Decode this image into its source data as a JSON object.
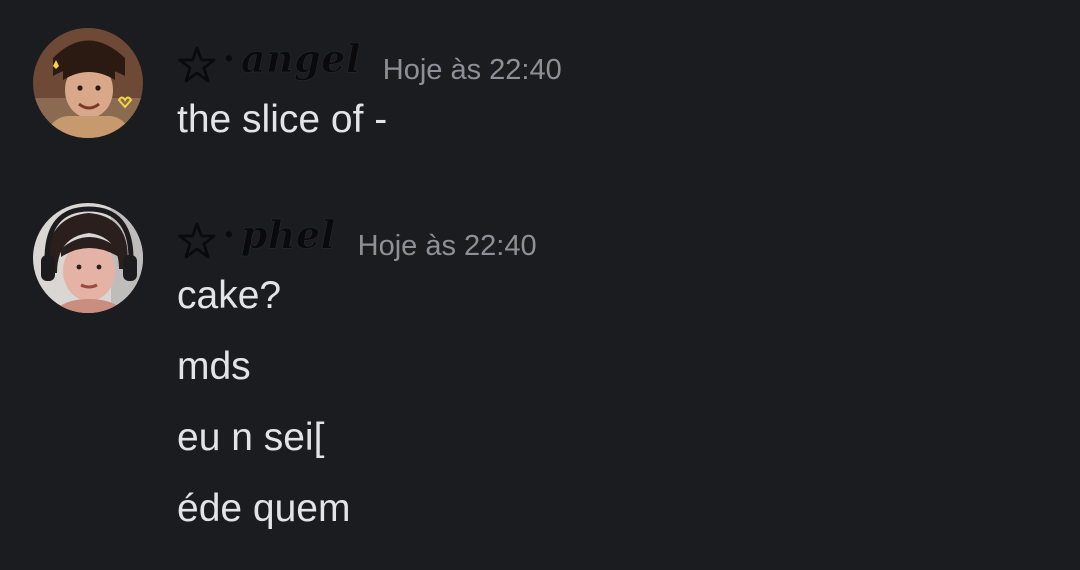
{
  "messages": [
    {
      "author": "angel",
      "separator": "·",
      "timestamp": "Hoje às 22:40",
      "avatar_icon": "user-avatar-angel",
      "lines": [
        "the slice of -"
      ]
    },
    {
      "author": "phel",
      "separator": "·",
      "timestamp": "Hoje às 22:40",
      "avatar_icon": "user-avatar-phel",
      "lines": [
        "cake?",
        "mds",
        "eu n sei[",
        "éde quem"
      ]
    }
  ],
  "colors": {
    "background": "#1b1c20",
    "text": "#e3e4e8",
    "timestamp": "#8e9097",
    "username": "#0a0a0c"
  },
  "icons": {
    "name_decoration": "pentagram-star-icon"
  }
}
